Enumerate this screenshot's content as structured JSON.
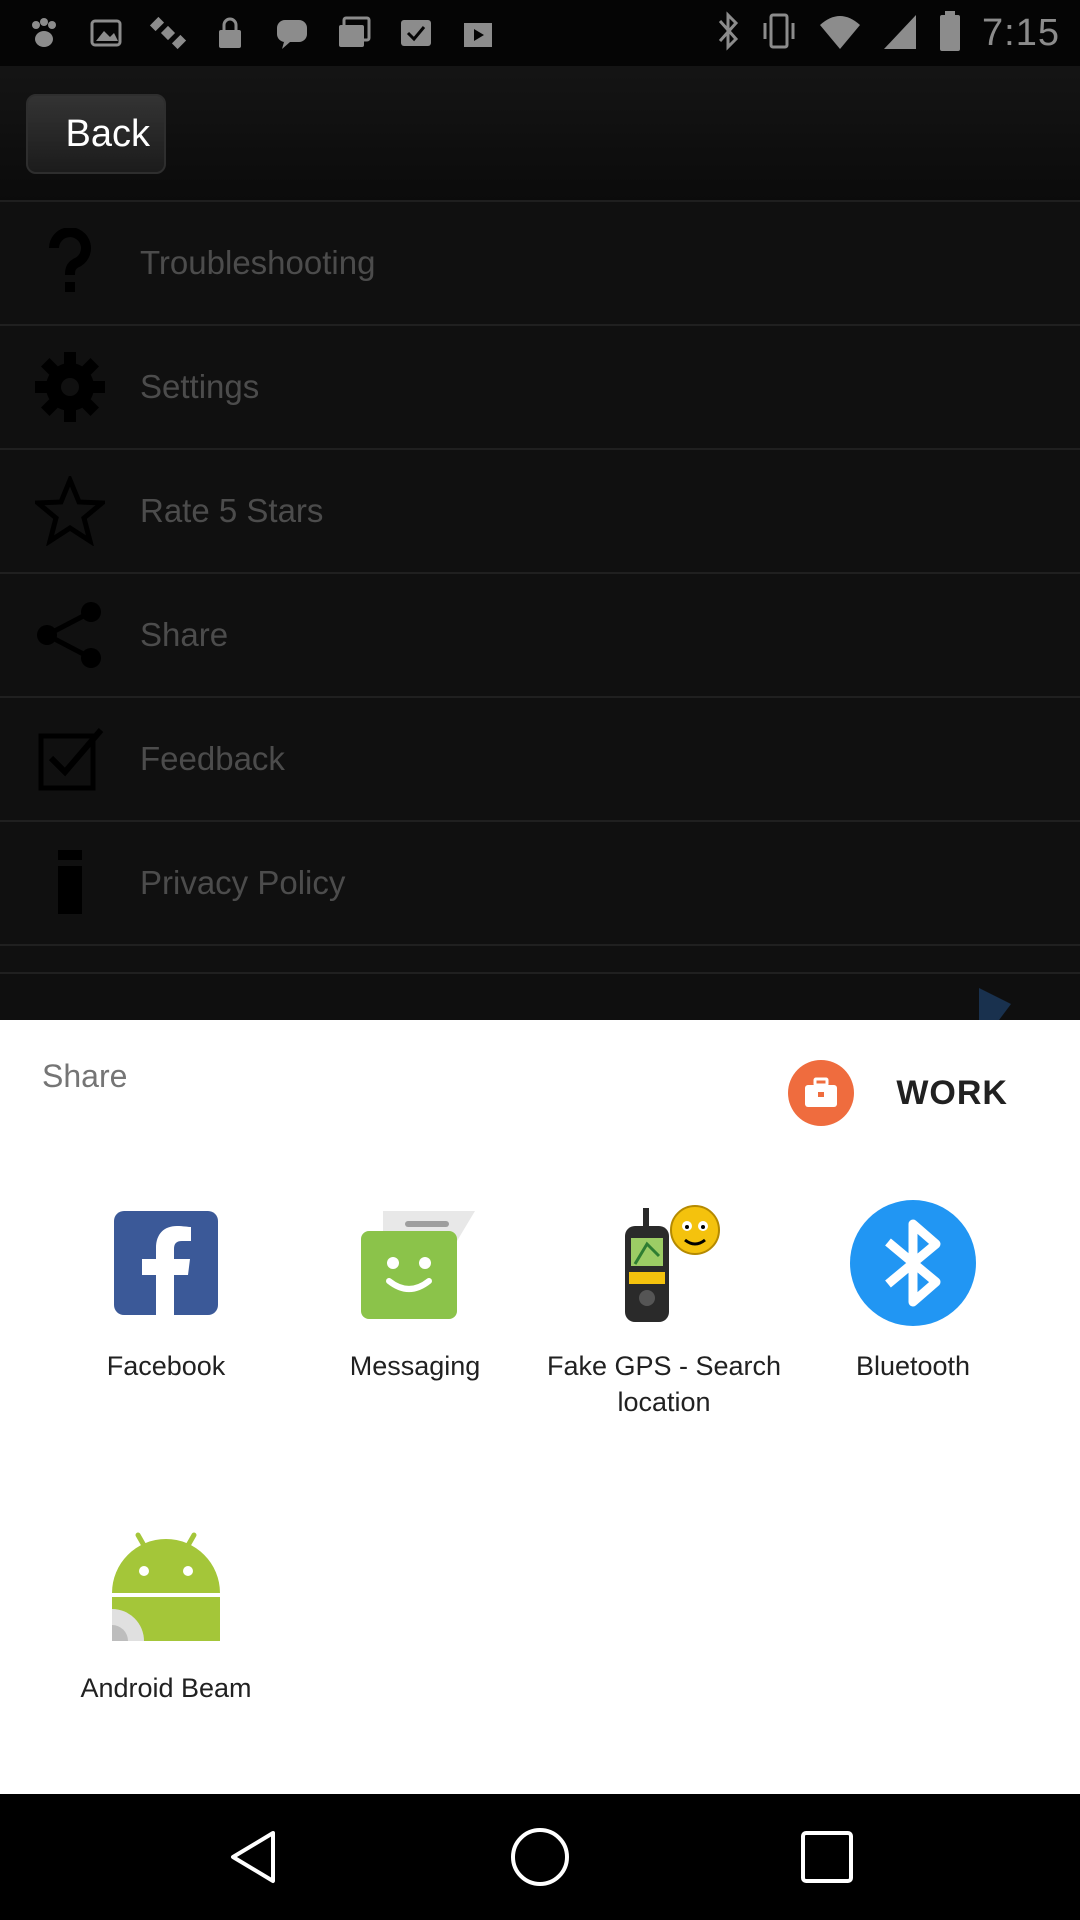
{
  "status_bar": {
    "time": "7:15",
    "icons": [
      "paw-icon",
      "gallery-icon",
      "fake-gps-satellite-icon",
      "lock-icon",
      "chat-bubble-icon",
      "photos-icon",
      "download-check-icon",
      "play-store-icon",
      "bluetooth-icon",
      "vibrate-icon",
      "wifi-icon",
      "signal-icon",
      "battery-icon"
    ]
  },
  "background_app": {
    "back_label": "Back",
    "menu": [
      {
        "label": "Troubleshooting",
        "icon": "question-icon"
      },
      {
        "label": "Settings",
        "icon": "gear-icon"
      },
      {
        "label": "Rate 5 Stars",
        "icon": "star-icon"
      },
      {
        "label": "Share",
        "icon": "share-icon"
      },
      {
        "label": "Feedback",
        "icon": "checkbox-icon"
      },
      {
        "label": "Privacy Policy",
        "icon": "info-icon"
      }
    ]
  },
  "share_sheet": {
    "title": "Share",
    "work_label": "WORK",
    "apps": [
      {
        "label": "Facebook",
        "icon": "facebook-icon"
      },
      {
        "label": "Messaging",
        "icon": "messaging-icon"
      },
      {
        "label": "Fake GPS - Search location",
        "icon": "fake-gps-icon"
      },
      {
        "label": "Bluetooth",
        "icon": "bluetooth-icon"
      },
      {
        "label": "Android Beam",
        "icon": "android-beam-icon"
      }
    ]
  },
  "colors": {
    "facebook": "#3b5998",
    "messaging": "#8bc34a",
    "bluetooth": "#2196f3",
    "work_badge": "#ef6c3e",
    "android": "#a4c639"
  },
  "nav_bar": {
    "buttons": [
      "back-nav-icon",
      "home-nav-icon",
      "recents-nav-icon"
    ]
  }
}
